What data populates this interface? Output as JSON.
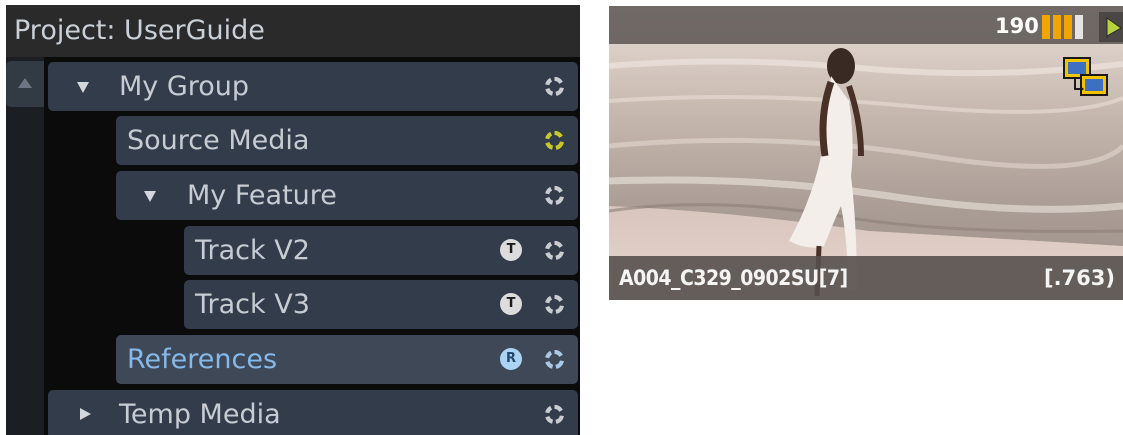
{
  "project": {
    "title": "Project: UserGuide"
  },
  "tree": {
    "rows": [
      {
        "label": "My Group",
        "expander": "expanded",
        "icon": "sync-circle-icon",
        "icon_color": "#c9cdd2"
      },
      {
        "label": "Source Media",
        "expander": "none",
        "icon": "sync-circle-icon",
        "icon_color": "#c8c826"
      },
      {
        "label": "My Feature",
        "expander": "expanded",
        "icon": "sync-circle-icon",
        "icon_color": "#c9cdd2"
      },
      {
        "label": "Track V2",
        "expander": "none",
        "badge": "T",
        "icon": "sync-circle-icon",
        "icon_color": "#c9cdd2"
      },
      {
        "label": "Track V3",
        "expander": "none",
        "badge": "T",
        "icon": "sync-circle-icon",
        "icon_color": "#c9cdd2"
      },
      {
        "label": "References",
        "expander": "none",
        "badge": "R",
        "selected": true,
        "icon": "sync-circle-icon",
        "icon_color": "#a9c9e6"
      },
      {
        "label": "Temp Media",
        "expander": "collapsed",
        "icon": "sync-circle-icon",
        "icon_color": "#c9cdd2"
      }
    ]
  },
  "thumbnail": {
    "clip_name": "A004_C329_0902SU[7]",
    "ratio": "[.763)",
    "frame_count": "190",
    "level_bars_filled": 3,
    "level_bars_total": 4,
    "accent_color": "#f2a400"
  }
}
